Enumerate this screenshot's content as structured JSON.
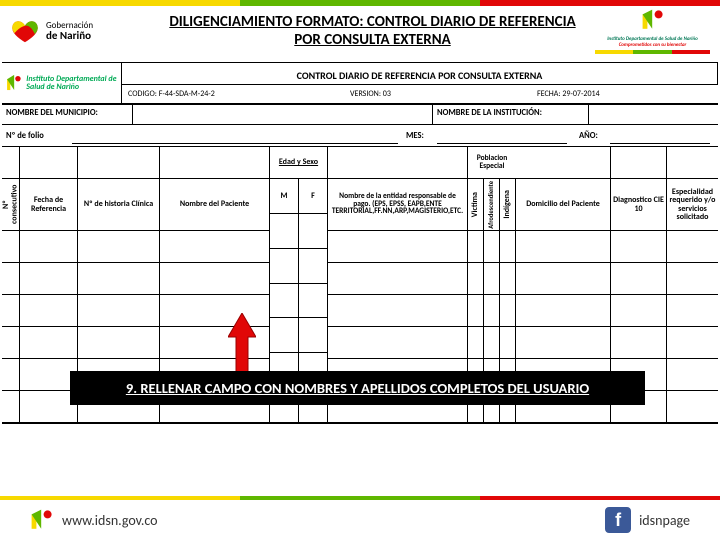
{
  "topbar": {
    "colors": [
      "#f7d900",
      "#5fb700",
      "#e10707"
    ]
  },
  "header": {
    "gob_label1": "Gobernación",
    "gob_label2": "de Nariño",
    "title": "DILIGENCIAMIENTO FORMATO: CONTROL DIARIO DE REFERENCIA POR CONSULTA EXTERNA",
    "idsn_line1": "Instituto Departamental de Salud de Nariño",
    "idsn_line2": "Comprometidos con su bienestar"
  },
  "form": {
    "logo_text": "Instituto Departamental de Salud de Nariño",
    "title": "CONTROL DIARIO DE REFERENCIA POR CONSULTA EXTERNA",
    "codigo": "CODIGO: F-44-SDA-M-24-2",
    "version": "VERSION: 03",
    "fecha": "FECHA: 29-07-2014",
    "lbl_municipio": "NOMBRE DEL MUNICIPIO:",
    "lbl_institucion": "NOMBRE DE LA INSTITUCIÓN:",
    "lbl_folio": "Nº de folio",
    "lbl_mes": "MES:",
    "lbl_anio": "AÑO:"
  },
  "columns": {
    "consecutivo": "Nº consecutivo",
    "fecha_ref": "Fecha de Referencia",
    "historia": "Nº de historia Clínica",
    "nombre": "Nombre del Paciente",
    "edad_sexo": "Edad y Sexo",
    "edad_m": "M",
    "edad_f": "F",
    "entidad": "Nombre de la entidad responsable de pago. (EPS, EPSS, EAPB,ENTE TERRITORIAL,FF.NN,ARP,MAGISTERIO,ETC.",
    "pob_especial": "Poblacion Especial",
    "victima": "Victima",
    "afro": "Afrodescendiente",
    "indigena": "Indígena",
    "domicilio": "Domicilio del Paciente",
    "diag": "Diagnostico CIE 10",
    "especialidad": "Especialidad requerido y/o servicios solicitado"
  },
  "callout": "9. RELLENAR CAMPO CON NOMBRES Y APELLIDOS COMPLETOS DEL USUARIO",
  "footer": {
    "url": "www.idsn.gov.co",
    "fb": "idsnpage"
  }
}
